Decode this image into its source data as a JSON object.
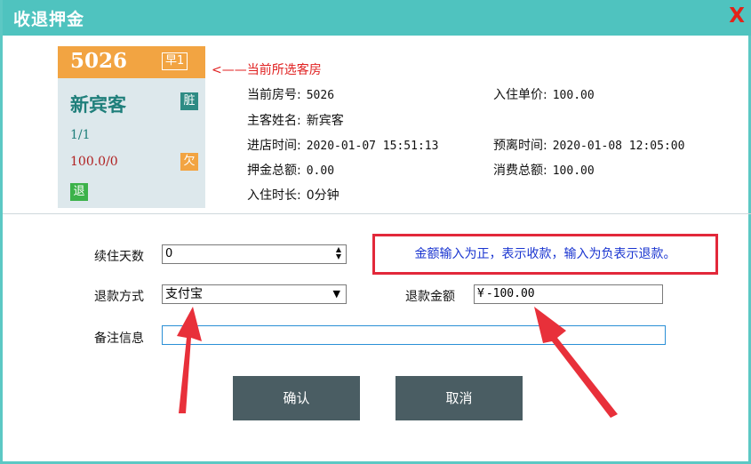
{
  "window": {
    "title": "收退押金",
    "close_symbol": "X"
  },
  "room_card": {
    "room_no": "5026",
    "tag": "早1",
    "guest": "新宾客",
    "count": "1/1",
    "amount": "100.0/0",
    "badge_dirty": "脏",
    "badge_owe": "欠",
    "badge_return": "退"
  },
  "current_room_note": "<——当前所选客房",
  "info": {
    "room_no": {
      "label": "当前房号:",
      "value": "5026"
    },
    "guest_name": {
      "label": "主客姓名:",
      "value": "新宾客"
    },
    "checkin_time": {
      "label": "进店时间:",
      "value": "2020-01-07 15:51:13"
    },
    "deposit_total": {
      "label": "押金总额:",
      "value": "0.00"
    },
    "stay_duration": {
      "label": "入住时长:",
      "value": "0分钟"
    },
    "unit_price": {
      "label": "入住单价:",
      "value": "100.00"
    },
    "depart_time": {
      "label": "预离时间:",
      "value": "2020-01-08 12:05:00"
    },
    "consume_total": {
      "label": "消费总额:",
      "value": "100.00"
    }
  },
  "form": {
    "extend_days": {
      "label": "续住天数",
      "value": "0"
    },
    "refund_method": {
      "label": "退款方式",
      "value": "支付宝"
    },
    "refund_amount": {
      "label": "退款金额",
      "currency": "¥",
      "value": "-100.00"
    },
    "remark": {
      "label": "备注信息",
      "value": ""
    },
    "notice": "金额输入为正，表示收款，输入为负表示退款。"
  },
  "buttons": {
    "confirm": "确认",
    "cancel": "取消"
  },
  "colors": {
    "title_bar": "#4fc3bf",
    "card_head": "#f2a442",
    "button": "#4a5d63",
    "notice_border": "#e2283a",
    "notice_text": "#1a35d0",
    "arrow": "#e8303a"
  }
}
